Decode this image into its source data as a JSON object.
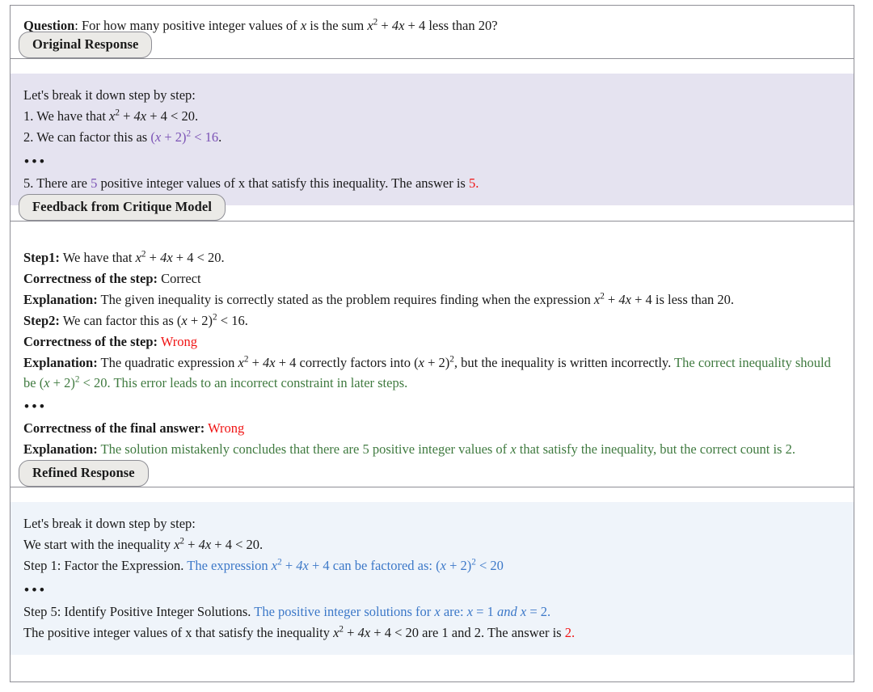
{
  "question": {
    "label": "Question",
    "text_before": ": For how many positive integer values of ",
    "var": "x",
    "text_mid": " is the sum ",
    "expr": "x² + 4x + 4",
    "text_after": " less than 20?"
  },
  "sections": [
    {
      "id": "original-response",
      "tab_label": "Original Response",
      "background": "#e5e3f0",
      "lines": [
        "Let's break it down step by step:",
        "1. We have that x² + 4x + 4 < 20.",
        "2. We can factor this as (x + 2)² < 16.",
        "•••",
        "5. There are 5 positive integer values of x that satisfy this inequality. The answer is 5."
      ]
    },
    {
      "id": "feedback-from-critique-model",
      "tab_label": "Feedback from Critique Model",
      "background": "#ffffff",
      "lines": [
        "Step1: We have that x² + 4x + 4 < 20.",
        "Correctness of the step: Correct",
        "Explanation: The given inequality is correctly stated as the problem requires finding when the expression x² + 4x + 4 is less than 20.",
        "Step2: We can factor this as (x + 2)² < 16.",
        "Correctness of the step: Wrong",
        "Explanation: The quadratic expression x² + 4x + 4 correctly factors into (x + 2)², but the inequality is written incorrectly. The correct inequality should be (x + 2)² < 20. This error leads to an incorrect constraint in later steps.",
        "•••",
        "Correctness of the final answer: Wrong",
        "Explanation: The solution mistakenly concludes that there are 5 positive integer values of x that satisfy the inequality, but the correct count is 2."
      ]
    },
    {
      "id": "refined-response",
      "tab_label": "Refined Response",
      "background": "#eff4fa",
      "lines": [
        "Let's break it down step by step:",
        "We start with the inequality x² + 4x + 4 < 20.",
        "Step 1: Factor the Expression. The expression x² + 4x + 4 can be factored as: (x + 2)² < 20",
        "•••",
        "Step 5: Identify Positive Integer Solutions. The positive integer solutions for x are: x = 1 and x = 2.",
        "The positive integer values of x that satisfy the inequality x² + 4x + 4 < 20 are 1 and 2. The answer is 2."
      ]
    }
  ],
  "labels": {
    "step1": "Step1:",
    "step2": "Step2:",
    "correctness_of_step": "Correctness of the step:",
    "correctness_of_final": "Correctness of the final answer:",
    "explanation": "Explanation:",
    "correct": "Correct",
    "wrong": "Wrong",
    "ellipsis": "•••",
    "lets_break": "Let's break it down step by step:"
  },
  "colors": {
    "purple": "#7b52b5",
    "red": "#f01414",
    "green": "#3f7a3f",
    "blue": "#3c78c8",
    "original_bg": "#e5e3f0",
    "refined_bg": "#eff4fa",
    "tab_bg": "#ebeae7",
    "border": "#8e8e95"
  },
  "original": {
    "l1": "Let's break it down step by step:",
    "l2_pre": "1. We have that ",
    "l2_expr": "x² + 4x + 4 < 20",
    "l2_post": ".",
    "l3_pre": "2. We can factor this as ",
    "l3_expr": "(x + 2)² < 16",
    "l3_post": ".",
    "l5_pre": "5. There are ",
    "l5_num": "5",
    "l5_mid": " positive integer values of x that satisfy this inequality. The answer is ",
    "l5_ans": "5."
  },
  "feedback": {
    "s1_text": "We have that ",
    "s1_expr": "x² + 4x + 4 < 20",
    "s1_post": ".",
    "s1_correctness": "Correct",
    "e1_text": "The given inequality is correctly stated as the problem requires finding when the expression ",
    "e1_expr": "x² + 4x + 4",
    "e1_post": " is less than 20.",
    "s2_text": "We can factor this as ",
    "s2_expr": "(x + 2)² < 16",
    "s2_post": ".",
    "s2_correctness": "Wrong",
    "e2_a": "The quadratic expression ",
    "e2_expr1": "x² + 4x + 4",
    "e2_b": " correctly factors into ",
    "e2_expr2": "(x + 2)²",
    "e2_c": ", but the inequality is written incorrectly.",
    "e2_green_a": "The correct inequality should be ",
    "e2_green_expr": "(x + 2)² < 20",
    "e2_green_b": ". This error leads to an incorrect constraint in later steps.",
    "final_correctness": "Wrong",
    "e3_a": "The solution mistakenly concludes that there are 5 positive integer values of ",
    "e3_var": "x",
    "e3_b": " that satisfy the inequality, but the correct count is 2."
  },
  "refined": {
    "l1": "Let's break it down step by step:",
    "l2_pre": "We start with the inequality ",
    "l2_expr": "x² + 4x + 4 < 20",
    "l2_post": ".",
    "l3_pre": "Step 1: Factor the Expression. ",
    "l3_blue_a": "The expression ",
    "l3_blue_expr1": "x² + 4x + 4",
    "l3_blue_b": " can be factored as: ",
    "l3_blue_expr2": "(x + 2)² < 20",
    "l5_pre": "Step 5: Identify Positive Integer Solutions. ",
    "l5_blue_a": "The positive integer solutions for ",
    "l5_blue_var": "x",
    "l5_blue_b": " are: ",
    "l5_blue_expr": "x = 1 and x = 2.",
    "l6_pre": "The positive integer values of x that satisfy the inequality ",
    "l6_expr": "x² + 4x + 4 < 20",
    "l6_mid": " are 1 and 2. The answer is ",
    "l6_ans": "2."
  }
}
